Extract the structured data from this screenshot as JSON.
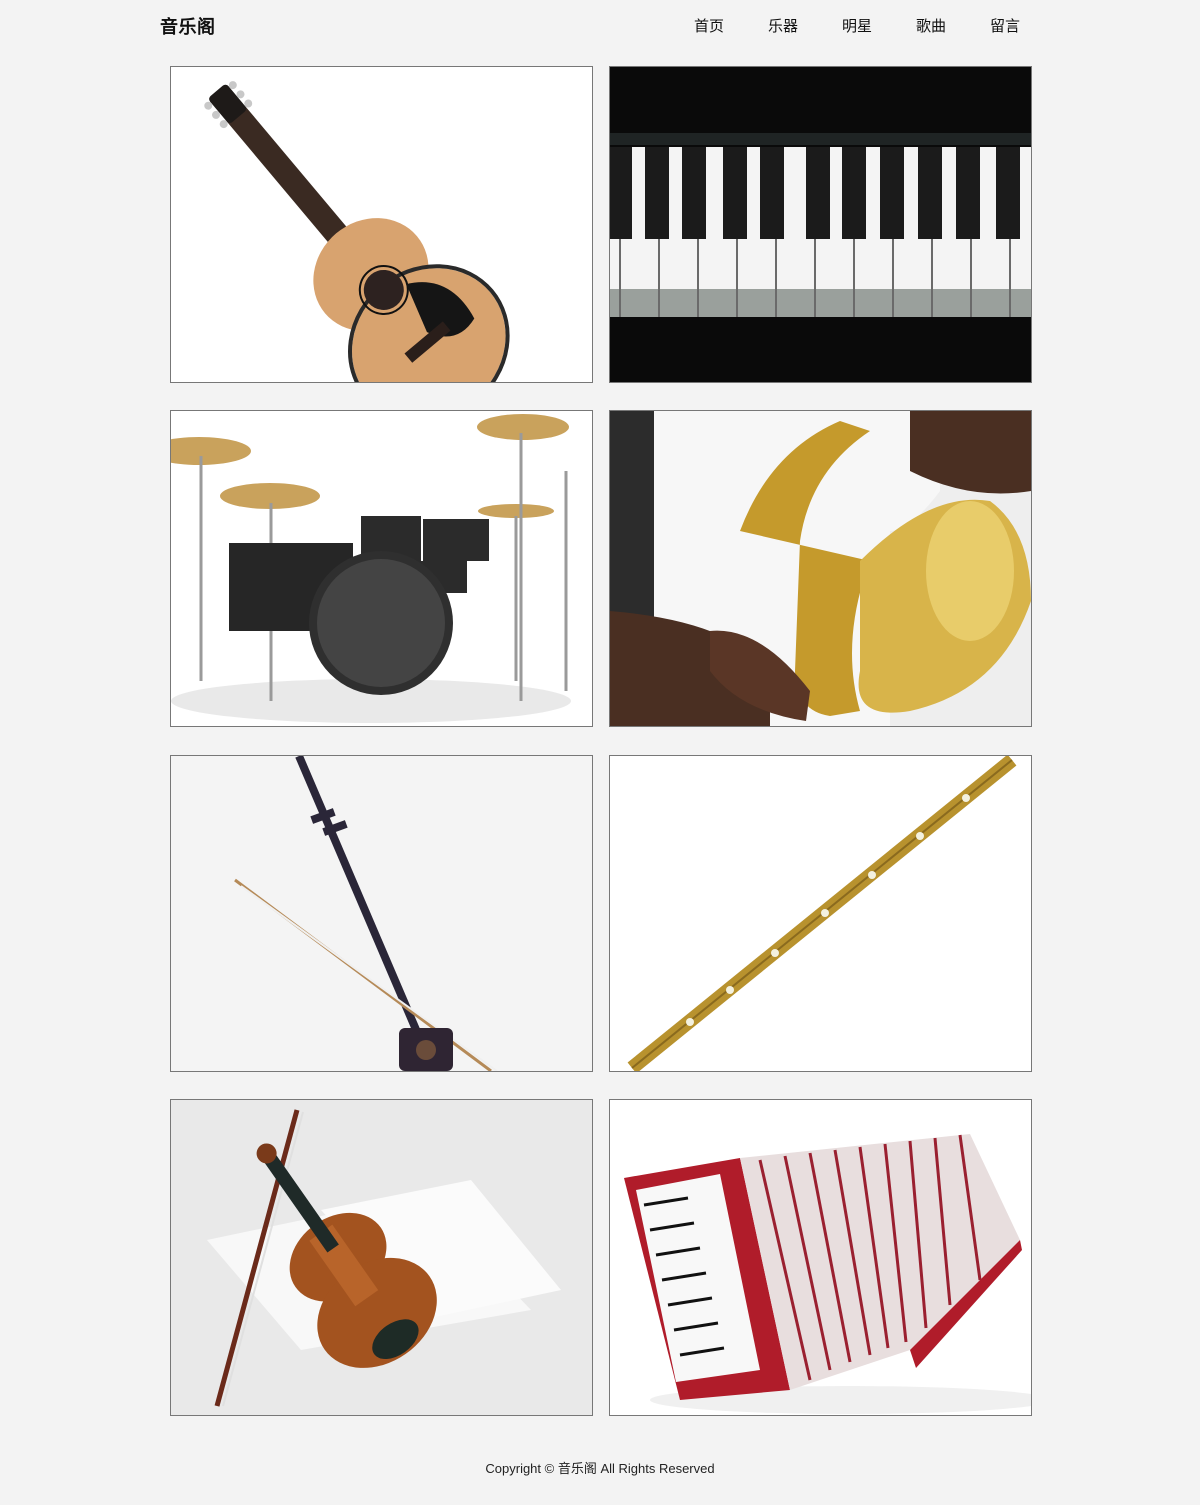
{
  "header": {
    "logo": "音乐阁",
    "nav": [
      "首页",
      "乐器",
      "明星",
      "歌曲",
      "留言"
    ]
  },
  "gallery": {
    "items": [
      {
        "icon": "acoustic-guitar-image"
      },
      {
        "icon": "piano-keys-image"
      },
      {
        "icon": "drum-kit-image"
      },
      {
        "icon": "saxophone-image"
      },
      {
        "icon": "erhu-image"
      },
      {
        "icon": "flute-image"
      },
      {
        "icon": "violin-image"
      },
      {
        "icon": "accordion-image"
      }
    ]
  },
  "footer": {
    "text": "Copyright © 音乐阁 All Rights Reserved"
  },
  "colors": {
    "background": "#f3f3f3",
    "card_border": "#777777"
  }
}
